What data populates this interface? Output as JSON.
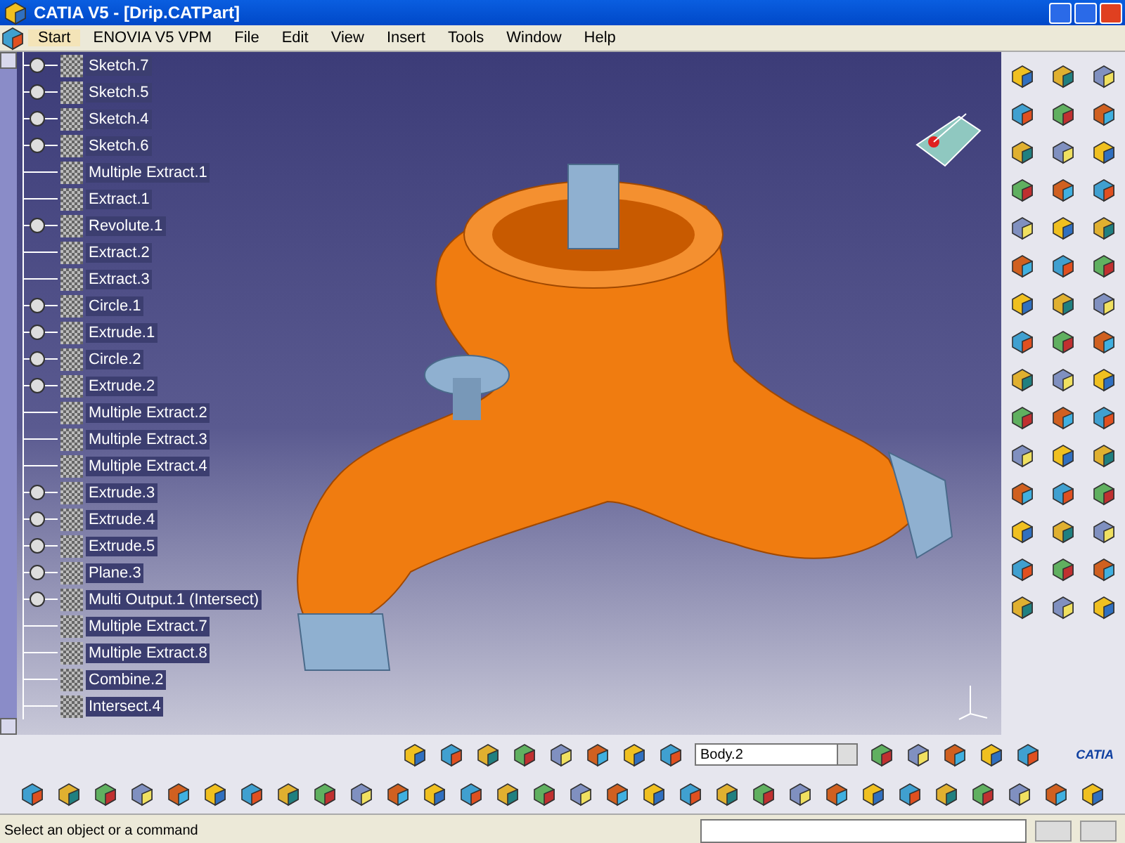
{
  "window": {
    "title": "CATIA V5 - [Drip.CATPart]"
  },
  "menu": [
    {
      "label": "Start",
      "selected": true
    },
    {
      "label": "ENOVIA V5 VPM",
      "selected": false
    },
    {
      "label": "File",
      "selected": false
    },
    {
      "label": "Edit",
      "selected": false
    },
    {
      "label": "View",
      "selected": false
    },
    {
      "label": "Insert",
      "selected": false
    },
    {
      "label": "Tools",
      "selected": false
    },
    {
      "label": "Window",
      "selected": false
    },
    {
      "label": "Help",
      "selected": false
    }
  ],
  "tree": [
    {
      "label": "Sketch.7",
      "expandable": true
    },
    {
      "label": "Sketch.5",
      "expandable": true
    },
    {
      "label": "Sketch.4",
      "expandable": true
    },
    {
      "label": "Sketch.6",
      "expandable": true
    },
    {
      "label": "Multiple Extract.1",
      "expandable": false
    },
    {
      "label": "Extract.1",
      "expandable": false
    },
    {
      "label": "Revolute.1",
      "expandable": true
    },
    {
      "label": "Extract.2",
      "expandable": false
    },
    {
      "label": "Extract.3",
      "expandable": false
    },
    {
      "label": "Circle.1",
      "expandable": true
    },
    {
      "label": "Extrude.1",
      "expandable": true
    },
    {
      "label": "Circle.2",
      "expandable": true
    },
    {
      "label": "Extrude.2",
      "expandable": true
    },
    {
      "label": "Multiple Extract.2",
      "expandable": false
    },
    {
      "label": "Multiple Extract.3",
      "expandable": false
    },
    {
      "label": "Multiple Extract.4",
      "expandable": false
    },
    {
      "label": "Extrude.3",
      "expandable": true
    },
    {
      "label": "Extrude.4",
      "expandable": true
    },
    {
      "label": "Extrude.5",
      "expandable": true
    },
    {
      "label": "Plane.3",
      "expandable": true
    },
    {
      "label": "Multi Output.1 (Intersect)",
      "expandable": true
    },
    {
      "label": "Multiple Extract.7",
      "expandable": false
    },
    {
      "label": "Multiple Extract.8",
      "expandable": false
    },
    {
      "label": "Combine.2",
      "expandable": false
    },
    {
      "label": "Intersect.4",
      "expandable": false
    }
  ],
  "body_selector": {
    "value": "Body.2"
  },
  "logo": {
    "text": "CATIA"
  },
  "status_bar": {
    "message": "Select an object or a command"
  }
}
